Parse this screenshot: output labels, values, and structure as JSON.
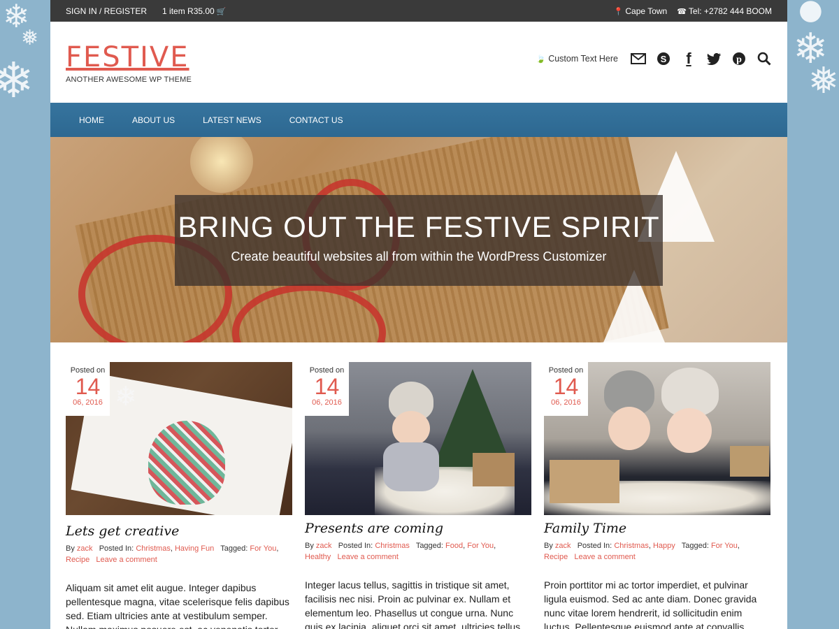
{
  "topbar": {
    "signin": "SIGN IN / REGISTER",
    "cart": "1 item R35.00",
    "location": "Cape Town",
    "phone": "Tel: +2782 444 BOOM"
  },
  "brand": {
    "logo": "FESTIVE",
    "tagline": "ANOTHER AWESOME WP THEME",
    "accent": "#e05a4f"
  },
  "header": {
    "custom_text": "Custom Text Here",
    "icons": [
      "email-icon",
      "skype-icon",
      "facebook-icon",
      "twitter-icon",
      "pinterest-icon",
      "search-icon"
    ]
  },
  "nav": {
    "items": [
      "HOME",
      "ABOUT US",
      "LATEST NEWS",
      "CONTACT US"
    ],
    "color": "#2d6891"
  },
  "hero": {
    "title": "BRING OUT THE FESTIVE SPIRIT",
    "subtitle": "Create beautiful websites all from within the WordPress Customizer"
  },
  "posts": [
    {
      "posted_on": "Posted on",
      "day": "14",
      "month_year": "06, 2016",
      "title": "Lets get creative",
      "by": "By",
      "author": "zack",
      "posted_in_label": "Posted In:",
      "categories": [
        "Christmas",
        "Having Fun"
      ],
      "tagged_label": "Tagged:",
      "tags": [
        "For You",
        "Recipe"
      ],
      "comment": "Leave a comment",
      "excerpt": "Aliquam sit amet elit augue. Integer dapibus pellentesque magna, vitae scelerisque felis dapibus sed. Etiam ultricies ante at vestibulum semper. Nullam maximus posuere est, ac venenatis tortor"
    },
    {
      "posted_on": "Posted on",
      "day": "14",
      "month_year": "06, 2016",
      "title": "Presents are coming",
      "by": "By",
      "author": "zack",
      "posted_in_label": "Posted In:",
      "categories": [
        "Christmas"
      ],
      "tagged_label": "Tagged:",
      "tags": [
        "Food",
        "For You",
        "Healthy"
      ],
      "comment": "Leave a comment",
      "excerpt": "Integer lacus tellus, sagittis in tristique sit amet, facilisis nec nisi. Proin ac pulvinar ex. Nullam et elementum leo. Phasellus ut congue urna. Nunc quis ex lacinia, aliquet orci sit amet, ultricies tellus."
    },
    {
      "posted_on": "Posted on",
      "day": "14",
      "month_year": "06, 2016",
      "title": "Family Time",
      "by": "By",
      "author": "zack",
      "posted_in_label": "Posted In:",
      "categories": [
        "Christmas",
        "Happy"
      ],
      "tagged_label": "Tagged:",
      "tags": [
        "For You",
        "Recipe"
      ],
      "comment": "Leave a comment",
      "excerpt": "Proin porttitor mi ac tortor imperdiet, et pulvinar ligula euismod. Sed ac ante diam. Donec gravida nunc vitae lorem hendrerit, id sollicitudin enim luctus. Pellentesque euismod ante at convallis"
    }
  ]
}
